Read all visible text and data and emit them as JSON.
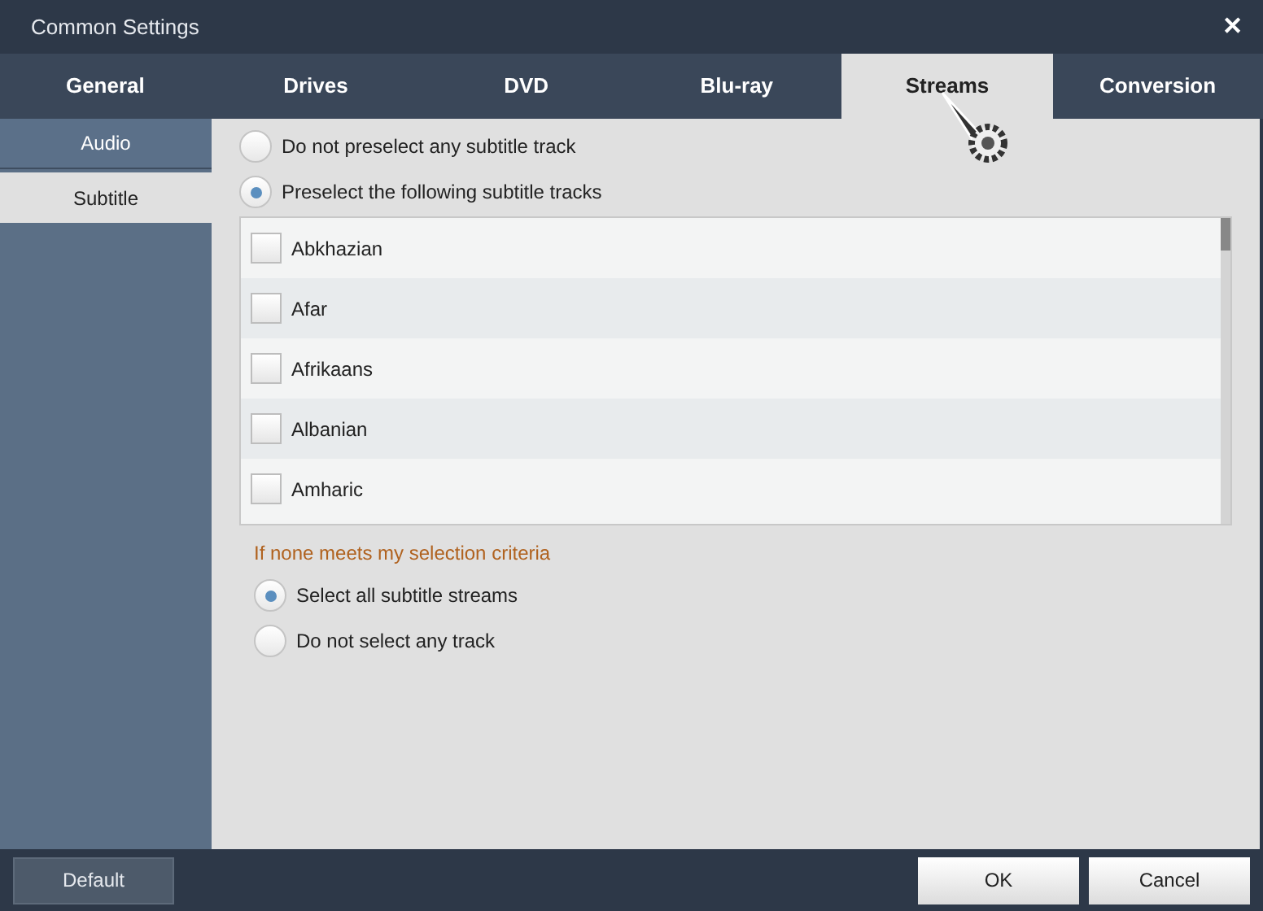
{
  "window": {
    "title": "Common Settings",
    "close": "✕"
  },
  "tabs": [
    {
      "label": "General",
      "selected": false
    },
    {
      "label": "Drives",
      "selected": false
    },
    {
      "label": "DVD",
      "selected": false
    },
    {
      "label": "Blu-ray",
      "selected": false
    },
    {
      "label": "Streams",
      "selected": true
    },
    {
      "label": "Conversion",
      "selected": false
    }
  ],
  "sidebar": {
    "items": [
      {
        "label": "Audio",
        "selected": false
      },
      {
        "label": "Subtitle",
        "selected": true
      }
    ]
  },
  "preselect_options": [
    {
      "label": "Do not preselect any subtitle track",
      "selected": false
    },
    {
      "label": "Preselect the following subtitle tracks",
      "selected": true
    }
  ],
  "languages": [
    {
      "label": "Abkhazian",
      "checked": false
    },
    {
      "label": "Afar",
      "checked": false
    },
    {
      "label": "Afrikaans",
      "checked": false
    },
    {
      "label": "Albanian",
      "checked": false
    },
    {
      "label": "Amharic",
      "checked": false
    }
  ],
  "fallback": {
    "heading": "If none meets my selection criteria",
    "options": [
      {
        "label": "Select all subtitle streams",
        "selected": true
      },
      {
        "label": "Do not select any track",
        "selected": false
      }
    ]
  },
  "buttons": {
    "default": "Default",
    "ok": "OK",
    "cancel": "Cancel"
  }
}
